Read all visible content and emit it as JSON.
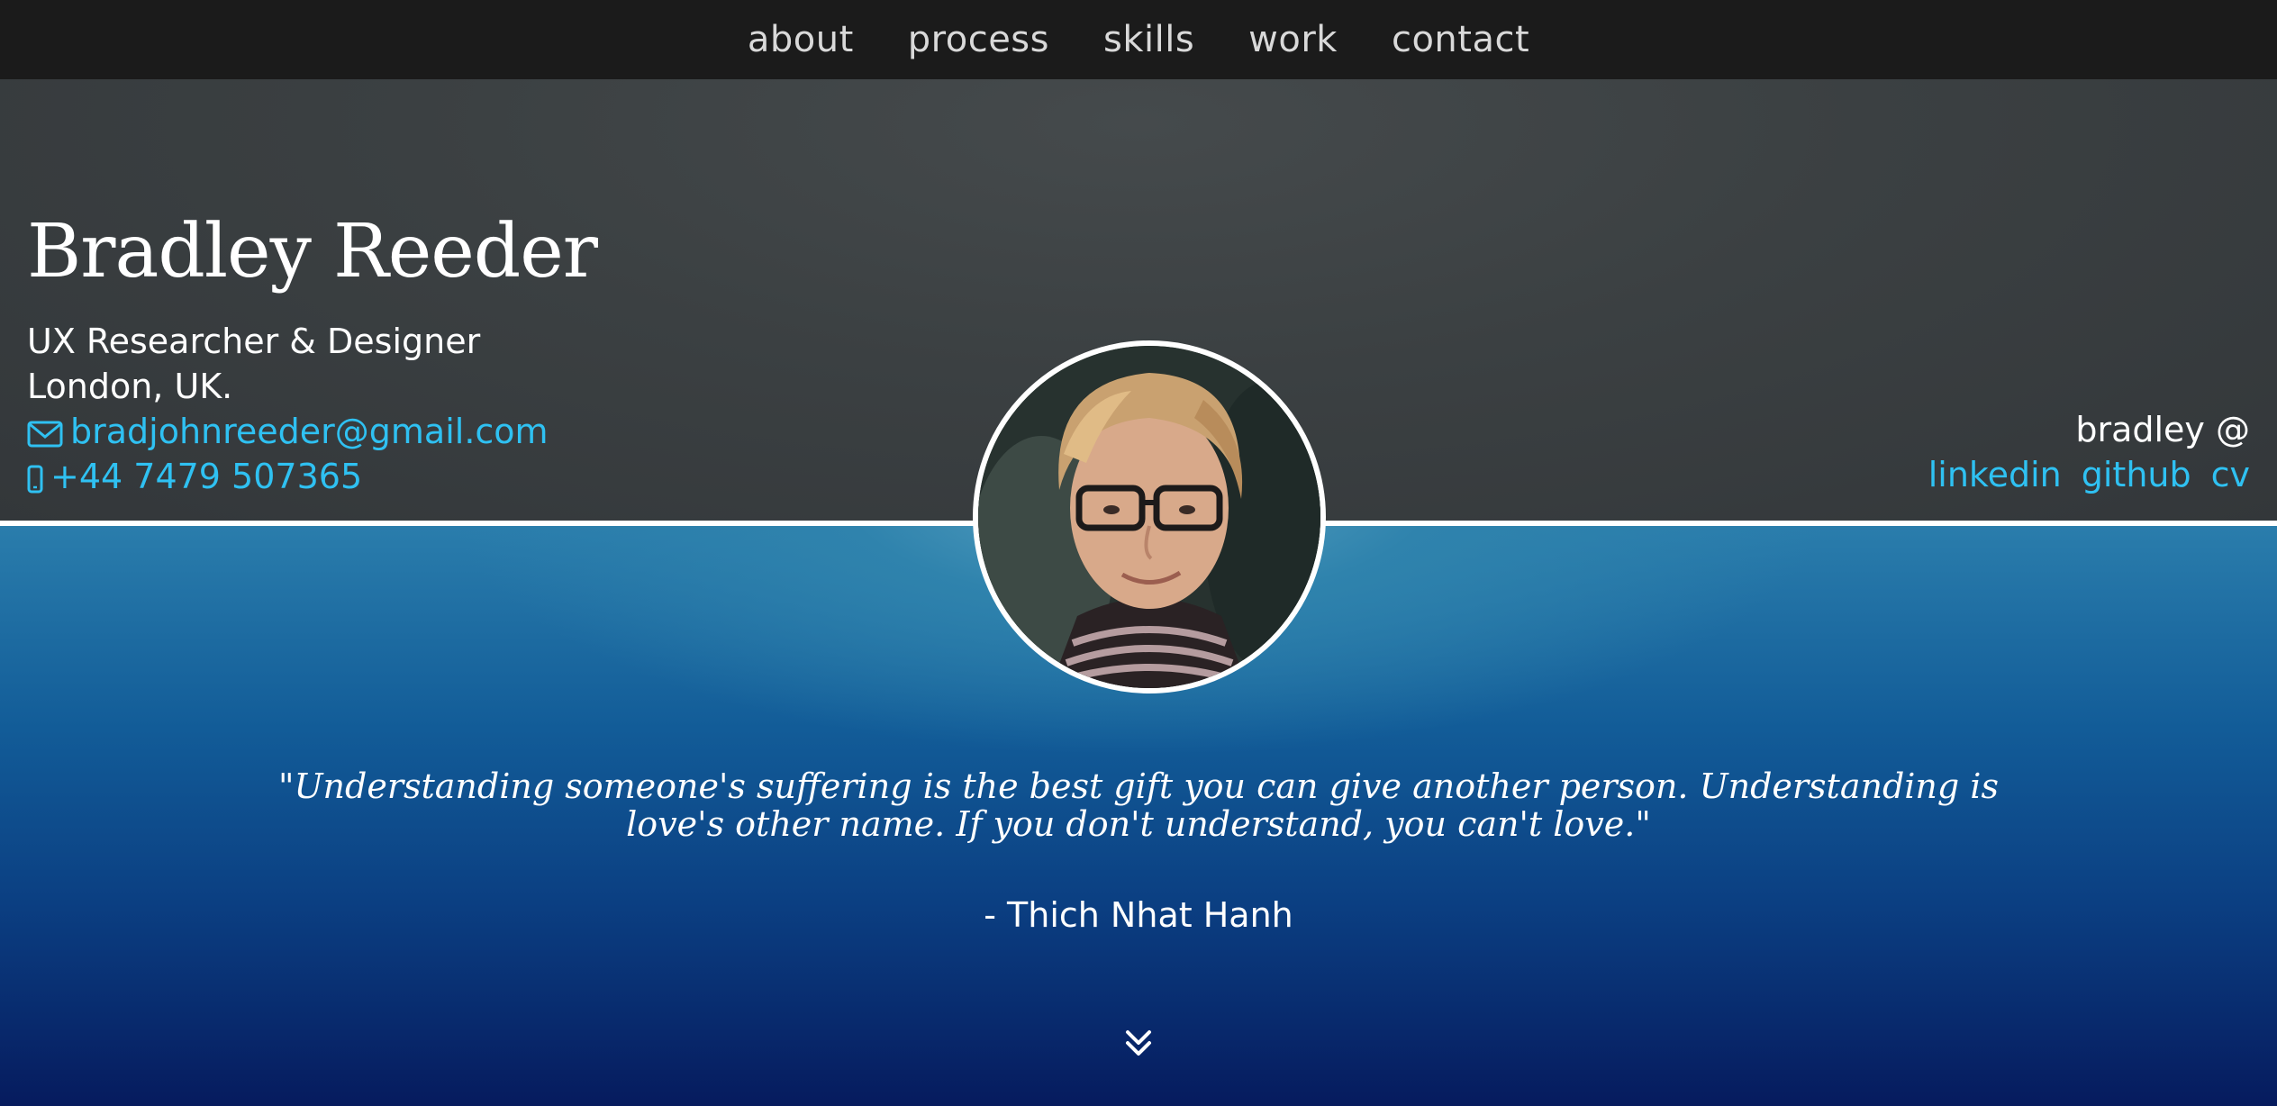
{
  "nav": {
    "items": [
      {
        "label": "about"
      },
      {
        "label": "process"
      },
      {
        "label": "skills"
      },
      {
        "label": "work"
      },
      {
        "label": "contact"
      }
    ]
  },
  "profile": {
    "name": "Bradley Reeder",
    "title": "UX Researcher & Designer",
    "location": "London, UK.",
    "email": "bradjohnreeder@gmail.com",
    "phone": "+44 7479 507365",
    "avatar_alt": "Bradley Reeder portrait"
  },
  "social": {
    "heading": "bradley @",
    "links": [
      {
        "label": "linkedin"
      },
      {
        "label": "github"
      },
      {
        "label": "cv"
      }
    ]
  },
  "quote": {
    "text": "\"Understanding someone's suffering is the best gift you can give another person. Understanding is love's other name. If you don't understand, you can't love.\"",
    "author": "- Thich Nhat Hanh"
  },
  "icons": {
    "email": "envelope-icon",
    "phone": "mobile-phone-icon",
    "scroll": "double-chevron-down-icon"
  },
  "colors": {
    "link": "#2fc1f2",
    "nav_background": "#1b1b1b",
    "header_background": "#3b4042",
    "hero_top": "#2a7dac",
    "hero_bottom": "#061b5e"
  }
}
